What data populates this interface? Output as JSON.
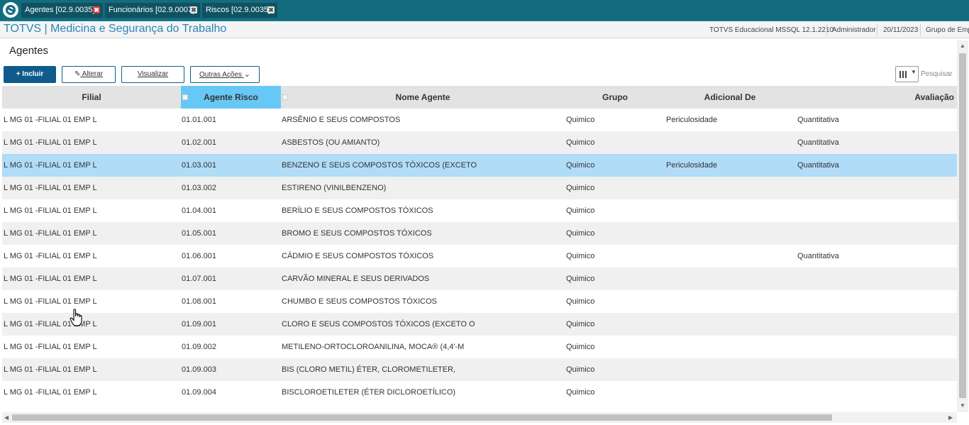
{
  "tabs": [
    {
      "label": "Agentes [02.9.0035]",
      "close": "✖"
    },
    {
      "label": "Funcionários [02.9.0007]",
      "close": "✖"
    },
    {
      "label": "Riscos [02.9.0035]",
      "close": "✖"
    }
  ],
  "app": {
    "title": "TOTVS | Medicina e Segurança do Trabalho",
    "environment": "TOTVS Educacional MSSQL 12.1.2210",
    "user": "Administrador",
    "date": "20/11/2023",
    "group": "Grupo de Emp"
  },
  "page": {
    "title": "Agentes"
  },
  "toolbar": {
    "incluir": "+ Incluir",
    "alterar": "Alterar",
    "visualizar": "Visualizar",
    "outras": "Outras Ações"
  },
  "search": {
    "placeholder": "Pesquisar"
  },
  "grid": {
    "headers": {
      "filial": "Filial",
      "agente": "Agente Risco",
      "nome": "Nome Agente",
      "grupo": "Grupo",
      "adicional": "Adicional De",
      "avaliacao": "Avaliação"
    },
    "rows": [
      {
        "filial": "L MG 01 -FILIAL 01 EMP L",
        "agente": "01.01.001",
        "nome": "ARSÊNIO E SEUS COMPOSTOS",
        "grupo": "Quimico",
        "adicional": "Periculosidade",
        "avaliacao": "Quantitativa"
      },
      {
        "filial": "L MG 01 -FILIAL 01 EMP L",
        "agente": "01.02.001",
        "nome": "ASBESTOS (OU AMIANTO)",
        "grupo": "Quimico",
        "adicional": "",
        "avaliacao": "Quantitativa"
      },
      {
        "filial": "L MG 01 -FILIAL 01 EMP L",
        "agente": "01.03.001",
        "nome": "BENZENO E SEUS COMPOSTOS TÓXICOS (EXCETO",
        "grupo": "Quimico",
        "adicional": "Periculosidade",
        "avaliacao": "Quantitativa"
      },
      {
        "filial": "L MG 01 -FILIAL 01 EMP L",
        "agente": "01.03.002",
        "nome": "ESTIRENO (VINILBENZENO)",
        "grupo": "Quimico",
        "adicional": "",
        "avaliacao": ""
      },
      {
        "filial": "L MG 01 -FILIAL 01 EMP L",
        "agente": "01.04.001",
        "nome": "BERÍLIO E SEUS COMPOSTOS TÓXICOS",
        "grupo": "Quimico",
        "adicional": "",
        "avaliacao": ""
      },
      {
        "filial": "L MG 01 -FILIAL 01 EMP L",
        "agente": "01.05.001",
        "nome": "BROMO E SEUS COMPOSTOS TÓXICOS",
        "grupo": "Quimico",
        "adicional": "",
        "avaliacao": ""
      },
      {
        "filial": "L MG 01 -FILIAL 01 EMP L",
        "agente": "01.06.001",
        "nome": "CÁDMIO E SEUS COMPOSTOS TÓXICOS",
        "grupo": "Quimico",
        "adicional": "",
        "avaliacao": "Quantitativa"
      },
      {
        "filial": "L MG 01 -FILIAL 01 EMP L",
        "agente": "01.07.001",
        "nome": "CARVÃO MINERAL E SEUS DERIVADOS",
        "grupo": "Quimico",
        "adicional": "",
        "avaliacao": ""
      },
      {
        "filial": "L MG 01 -FILIAL 01 EMP L",
        "agente": "01.08.001",
        "nome": "CHUMBO E SEUS COMPOSTOS TÓXICOS",
        "grupo": "Quimico",
        "adicional": "",
        "avaliacao": ""
      },
      {
        "filial": "L MG 01 -FILIAL 01 EMP L",
        "agente": "01.09.001",
        "nome": "CLORO E SEUS COMPOSTOS TÓXICOS (EXCETO O",
        "grupo": "Quimico",
        "adicional": "",
        "avaliacao": ""
      },
      {
        "filial": "L MG 01 -FILIAL 01 EMP L",
        "agente": "01.09.002",
        "nome": "METILENO-ORTOCLOROANILINA, MOCA® (4,4'-M",
        "grupo": "Quimico",
        "adicional": "",
        "avaliacao": ""
      },
      {
        "filial": "L MG 01 -FILIAL 01 EMP L",
        "agente": "01.09.003",
        "nome": "BIS (CLORO METIL) ÉTER, CLOROMETILETER,",
        "grupo": "Quimico",
        "adicional": "",
        "avaliacao": ""
      },
      {
        "filial": "L MG 01 -FILIAL 01 EMP L",
        "agente": "01.09.004",
        "nome": "BISCLOROETILETER (ÉTER DICLOROETÍLICO)",
        "grupo": "Quimico",
        "adicional": "",
        "avaliacao": ""
      }
    ],
    "selected_row": 3
  },
  "colors": {
    "topbar": "#136c7e",
    "primary": "#0f5b8c",
    "header_sorted": "#67c8f5",
    "row_selected": "#b0dcf8",
    "close_active": "#e53935"
  }
}
